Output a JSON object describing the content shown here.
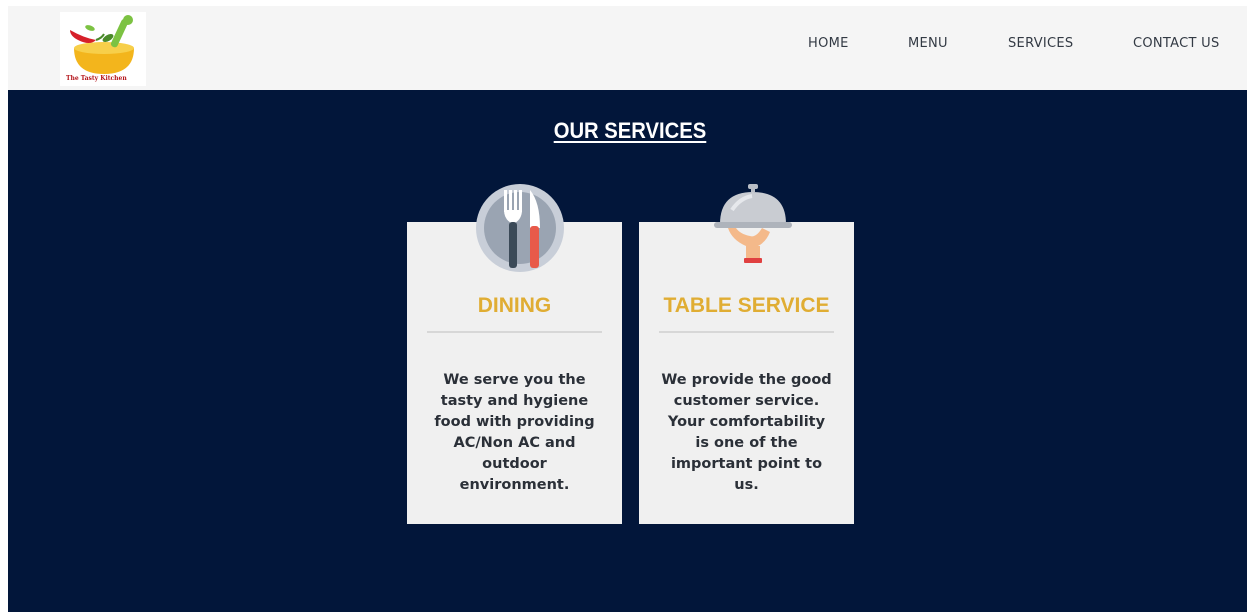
{
  "brand": {
    "logo_text": "The Tasty Kitchen",
    "colors": {
      "navbar_bg": "#f5f5f5",
      "section_bg": "#02163a",
      "card_bg": "#f0f0f0",
      "accent": "#e0ad33"
    }
  },
  "nav": {
    "items": [
      {
        "label": "HOME"
      },
      {
        "label": "MENU"
      },
      {
        "label": "SERVICES"
      },
      {
        "label": "CONTACT US"
      }
    ]
  },
  "services": {
    "title": "OUR SERVICES",
    "cards": [
      {
        "icon": "fork-knife-icon",
        "title": "DINING",
        "description": "We serve you the tasty and hygiene food with providing AC/Non AC and outdoor environment."
      },
      {
        "icon": "serving-cloche-icon",
        "title": "TABLE SERVICE",
        "description": "We provide the good customer service. Your comfortability is one of the important point to us."
      }
    ]
  }
}
